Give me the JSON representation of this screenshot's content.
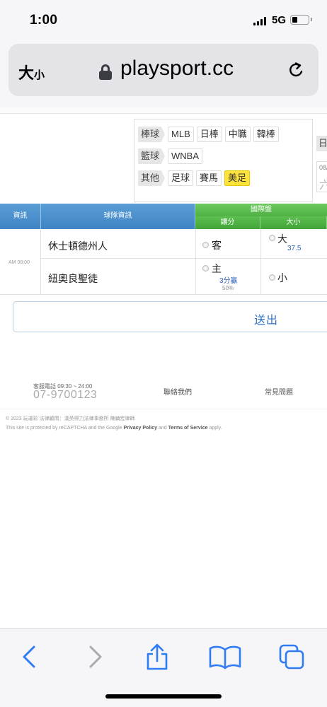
{
  "status": {
    "time": "1:00",
    "network": "5G"
  },
  "browser": {
    "text_size_label": "大",
    "text_size_small": "小",
    "url": "playsport.cc"
  },
  "filters": {
    "rows": [
      {
        "category": "棒球",
        "tags": [
          "MLB",
          "日棒",
          "中職",
          "韓棒"
        ]
      },
      {
        "category": "籃球",
        "tags": [
          "WNBA"
        ]
      },
      {
        "category": "其他",
        "tags": [
          "足球",
          "賽馬",
          "美足"
        ]
      }
    ],
    "active_tag": "美足",
    "right_tag": "日",
    "right_box_date": "08/",
    "right_box_char": "六"
  },
  "table": {
    "headers": {
      "info": "資訊",
      "teams": "球隊資訊",
      "intl": "國際盤",
      "spread": "讓分",
      "total": "大小"
    },
    "game_time": "AM 08:00",
    "away_team": "休士頓德州人",
    "home_team": "紐奧良聖徒",
    "away_label": "客",
    "home_label": "主",
    "home_spread": "3分贏",
    "home_pct": "50%",
    "over_label": "大",
    "over_value": "37.5",
    "under_label": "小"
  },
  "submit_label": "送出",
  "footer": {
    "service_label": "客服電話 09:30 ~ 24:00",
    "service_phone": "07-9700123",
    "contact": "聯絡我們",
    "faq": "常見問題",
    "copyright": "© 2023 玩運彩 法律顧問：漢英得力法律事務所 陳鎮宏律師",
    "recaptcha_pre": "This site is protected by reCAPTCHA and the Google ",
    "privacy": "Privacy Policy",
    "and": " and ",
    "terms": "Terms of Service",
    "apply": " apply."
  }
}
